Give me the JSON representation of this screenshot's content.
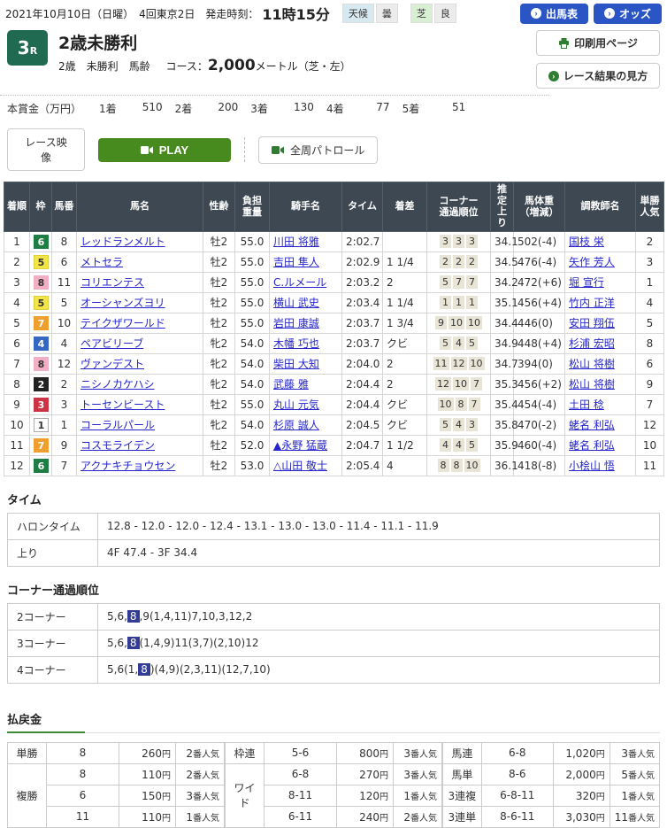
{
  "topbar": {
    "date_text": "2021年10月10日（日曜）　4回東京2日　発走時刻：",
    "start_time": "11時15分",
    "weather_label": "天候",
    "weather_value": "曇",
    "turf_label": "芝",
    "turf_value": "良",
    "entries_button": "出馬表",
    "odds_button": "オッズ",
    "arrow_glyph": "›"
  },
  "race_header": {
    "race_number": "3",
    "race_suffix": "R",
    "title": "2歳未勝利",
    "conditions": "2歳　未勝利　馬齢",
    "course_label": "コース：",
    "course_distance": "2,000",
    "course_detail": "メートル（芝・左）",
    "print_button": "印刷用ページ",
    "guide_button": "レース結果の見方"
  },
  "prize": {
    "label": "本賞金（万円）",
    "items": [
      {
        "rank": "1着",
        "amount": "510"
      },
      {
        "rank": "2着",
        "amount": "200"
      },
      {
        "rank": "3着",
        "amount": "130"
      },
      {
        "rank": "4着",
        "amount": "77"
      },
      {
        "rank": "5着",
        "amount": "51"
      }
    ]
  },
  "video_bar": {
    "race_video_label": "レース映像",
    "play_label": "PLAY",
    "patrol_label": "全周パトロール"
  },
  "results": {
    "headers": {
      "pos": "着順",
      "frame": "枠",
      "num": "馬番",
      "horse": "馬名",
      "sexage": "性齢",
      "weight_l1": "負担",
      "weight_l2": "重量",
      "jockey": "騎手名",
      "time": "タイム",
      "margin": "着差",
      "corner_l1": "コーナー",
      "corner_l2": "通過順位",
      "last3f": "推定上り",
      "body_l1": "馬体重",
      "body_l2": "（増減）",
      "trainer": "調教師名",
      "fav_l1": "単勝",
      "fav_l2": "人気"
    },
    "rows": [
      {
        "pos": "1",
        "frame": "6",
        "num": "8",
        "horse": "レッドランメルト",
        "sexage": "牡2",
        "weight": "55.0",
        "jockey": "川田 将雅",
        "time": "2:02.7",
        "margin": "",
        "corners": [
          "3",
          "3",
          "3"
        ],
        "last3f": "34.1",
        "body": "502(-4)",
        "trainer": "国枝 栄",
        "fav": "2"
      },
      {
        "pos": "2",
        "frame": "5",
        "num": "6",
        "horse": "メトセラ",
        "sexage": "牡2",
        "weight": "55.0",
        "jockey": "吉田 隼人",
        "time": "2:02.9",
        "margin": "1 1/4",
        "corners": [
          "2",
          "2",
          "2"
        ],
        "last3f": "34.5",
        "body": "476(-4)",
        "trainer": "矢作 芳人",
        "fav": "3"
      },
      {
        "pos": "3",
        "frame": "8",
        "num": "11",
        "horse": "コリエンテス",
        "sexage": "牡2",
        "weight": "55.0",
        "jockey": "C.ルメール",
        "time": "2:03.2",
        "margin": "2",
        "corners": [
          "5",
          "7",
          "7"
        ],
        "last3f": "34.2",
        "body": "472(+6)",
        "trainer": "堀 宣行",
        "fav": "1"
      },
      {
        "pos": "4",
        "frame": "5",
        "num": "5",
        "horse": "オーシャンズヨリ",
        "sexage": "牡2",
        "weight": "55.0",
        "jockey": "横山 武史",
        "time": "2:03.4",
        "margin": "1 1/4",
        "corners": [
          "1",
          "1",
          "1"
        ],
        "last3f": "35.1",
        "body": "456(+4)",
        "trainer": "竹内 正洋",
        "fav": "4"
      },
      {
        "pos": "5",
        "frame": "7",
        "num": "10",
        "horse": "テイクザワールド",
        "sexage": "牡2",
        "weight": "55.0",
        "jockey": "岩田 康誠",
        "time": "2:03.7",
        "margin": "1 3/4",
        "corners": [
          "9",
          "10",
          "10"
        ],
        "last3f": "34.4",
        "body": "446(0)",
        "trainer": "安田 翔伍",
        "fav": "5"
      },
      {
        "pos": "6",
        "frame": "4",
        "num": "4",
        "horse": "ペアビリーブ",
        "sexage": "牝2",
        "weight": "54.0",
        "jockey": "木幡 巧也",
        "time": "2:03.7",
        "margin": "クビ",
        "corners": [
          "5",
          "4",
          "5"
        ],
        "last3f": "34.9",
        "body": "448(+4)",
        "trainer": "杉浦 宏昭",
        "fav": "8"
      },
      {
        "pos": "7",
        "frame": "8",
        "num": "12",
        "horse": "ヴァンデスト",
        "sexage": "牝2",
        "weight": "54.0",
        "jockey": "柴田 大知",
        "time": "2:04.0",
        "margin": "2",
        "corners": [
          "11",
          "12",
          "10"
        ],
        "last3f": "34.7",
        "body": "394(0)",
        "trainer": "松山 将樹",
        "fav": "6"
      },
      {
        "pos": "8",
        "frame": "2",
        "num": "2",
        "horse": "ニシノカケハシ",
        "sexage": "牝2",
        "weight": "54.0",
        "jockey": "武藤 雅",
        "time": "2:04.4",
        "margin": "2",
        "corners": [
          "12",
          "10",
          "7"
        ],
        "last3f": "35.3",
        "body": "456(+2)",
        "trainer": "松山 将樹",
        "fav": "9"
      },
      {
        "pos": "9",
        "frame": "3",
        "num": "3",
        "horse": "トーセンビースト",
        "sexage": "牡2",
        "weight": "55.0",
        "jockey": "丸山 元気",
        "time": "2:04.4",
        "margin": "クビ",
        "corners": [
          "10",
          "8",
          "7"
        ],
        "last3f": "35.4",
        "body": "454(-4)",
        "trainer": "土田 稔",
        "fav": "7"
      },
      {
        "pos": "10",
        "frame": "1",
        "num": "1",
        "horse": "コーラルパール",
        "sexage": "牝2",
        "weight": "54.0",
        "jockey": "杉原 誠人",
        "time": "2:04.5",
        "margin": "クビ",
        "corners": [
          "5",
          "4",
          "3"
        ],
        "last3f": "35.8",
        "body": "470(-2)",
        "trainer": "蛯名 利弘",
        "fav": "12"
      },
      {
        "pos": "11",
        "frame": "7",
        "num": "9",
        "horse": "コスモライデン",
        "sexage": "牡2",
        "weight": "52.0",
        "jockey": "▲永野 猛蔵",
        "time": "2:04.7",
        "margin": "1 1/2",
        "corners": [
          "4",
          "4",
          "5"
        ],
        "last3f": "35.9",
        "body": "460(-4)",
        "trainer": "蛯名 利弘",
        "fav": "10"
      },
      {
        "pos": "12",
        "frame": "6",
        "num": "7",
        "horse": "アクナキチョウセン",
        "sexage": "牡2",
        "weight": "53.0",
        "jockey": "△山田 敬士",
        "time": "2:05.4",
        "margin": "4",
        "corners": [
          "8",
          "8",
          "10"
        ],
        "last3f": "36.1",
        "body": "418(-8)",
        "trainer": "小桧山 悟",
        "fav": "11"
      }
    ]
  },
  "time_section": {
    "heading": "タイム",
    "rows": [
      {
        "label": "ハロンタイム",
        "value": "12.8 - 12.0 - 12.0 - 12.4 - 13.1 - 13.0 - 13.0 - 11.4 - 11.1 - 11.9"
      },
      {
        "label": "上り",
        "value": "4F 47.4 - 3F 34.4"
      }
    ]
  },
  "corner_section": {
    "heading": "コーナー通過順位",
    "rows": [
      {
        "label": "2コーナー",
        "pre": "5,6,",
        "highlight": "8",
        "post": ",9(1,4,11)7,10,3,12,2"
      },
      {
        "label": "3コーナー",
        "pre": "5,6,",
        "highlight": "8",
        "post": "(1,4,9)11(3,7)(2,10)12"
      },
      {
        "label": "4コーナー",
        "pre": "5,6(1,",
        "highlight": "8",
        "post": ")(4,9)(2,3,11)(12,7,10)"
      }
    ]
  },
  "payout": {
    "heading": "払戻金",
    "yen": "円",
    "fav_suffix": "番人気",
    "groups": [
      {
        "cells": [
          {
            "label": "単勝",
            "rows": [
              {
                "combo": "8",
                "amount": "260",
                "fav": "2"
              }
            ]
          },
          {
            "label": "複勝",
            "rows": [
              {
                "combo": "8",
                "amount": "110",
                "fav": "2"
              },
              {
                "combo": "6",
                "amount": "150",
                "fav": "3"
              },
              {
                "combo": "11",
                "amount": "110",
                "fav": "1"
              }
            ]
          }
        ]
      },
      {
        "cells": [
          {
            "label": "枠連",
            "rows": [
              {
                "combo": "5-6",
                "amount": "800",
                "fav": "3"
              }
            ]
          },
          {
            "label": "ワイド",
            "rows": [
              {
                "combo": "6-8",
                "amount": "270",
                "fav": "3"
              },
              {
                "combo": "8-11",
                "amount": "120",
                "fav": "1"
              },
              {
                "combo": "6-11",
                "amount": "240",
                "fav": "2"
              }
            ]
          }
        ]
      },
      {
        "cells": [
          {
            "label": "馬連",
            "rows": [
              {
                "combo": "6-8",
                "amount": "1,020",
                "fav": "3"
              }
            ]
          },
          {
            "label": "馬単",
            "rows": [
              {
                "combo": "8-6",
                "amount": "2,000",
                "fav": "5"
              }
            ]
          },
          {
            "label": "3連複",
            "rows": [
              {
                "combo": "6-8-11",
                "amount": "320",
                "fav": "1"
              }
            ]
          },
          {
            "label": "3連単",
            "rows": [
              {
                "combo": "8-6-11",
                "amount": "3,030",
                "fav": "11"
              }
            ]
          }
        ]
      }
    ]
  },
  "colors": {
    "accent_blue": "#2b55c4",
    "play_green": "#478a1d",
    "icon_green": "#2e7d32",
    "race_badge_green": "#1f6a50",
    "table_header_dark": "#3d4852",
    "corner_highlight": "#323b96",
    "payout_label_bg": "#ebe8d9",
    "frames": {
      "1": {
        "bg": "#ffffff",
        "fg": "#333333",
        "border": "#aaaaaa"
      },
      "2": {
        "bg": "#222222",
        "fg": "#ffffff",
        "border": "#222222"
      },
      "3": {
        "bg": "#cc3344",
        "fg": "#ffffff",
        "border": "#cc3344"
      },
      "4": {
        "bg": "#3567c0",
        "fg": "#ffffff",
        "border": "#3567c0"
      },
      "5": {
        "bg": "#f2e545",
        "fg": "#333333",
        "border": "#ddd040"
      },
      "6": {
        "bg": "#1e7d42",
        "fg": "#ffffff",
        "border": "#1e7d42"
      },
      "7": {
        "bg": "#ef9f2f",
        "fg": "#ffffff",
        "border": "#ef9f2f"
      },
      "8": {
        "bg": "#f2afc4",
        "fg": "#333333",
        "border": "#f2afc4"
      }
    }
  }
}
